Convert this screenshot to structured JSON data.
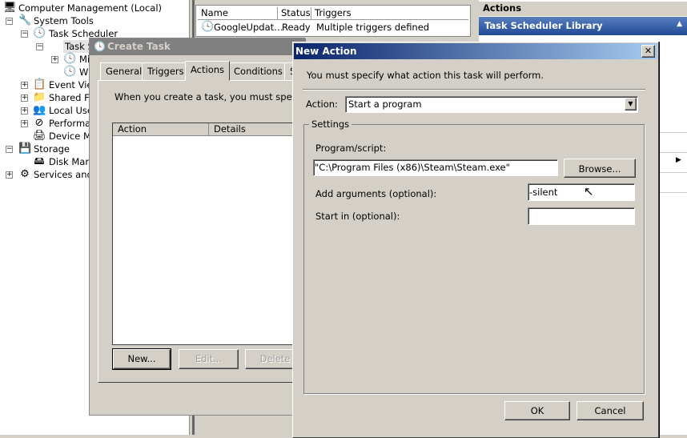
{
  "tree": {
    "items": [
      {
        "label": "Computer Management (Local)",
        "icon": "computer-icon"
      },
      {
        "label": "System Tools",
        "icon": "tools-icon",
        "expander": "−"
      },
      {
        "label": "Task Scheduler",
        "icon": "clock-icon",
        "expander": "−"
      },
      {
        "label": "Task S",
        "icon": "",
        "expander": "−"
      },
      {
        "label": "Mi",
        "icon": "task-folder-icon",
        "expander": "+"
      },
      {
        "label": "WI",
        "icon": "task-folder-icon"
      },
      {
        "label": "Event View",
        "icon": "event-viewer-icon",
        "expander": "+"
      },
      {
        "label": "Shared Fo",
        "icon": "shared-folder-icon",
        "expander": "+"
      },
      {
        "label": "Local User",
        "icon": "users-icon",
        "expander": "+"
      },
      {
        "label": "Performan",
        "icon": "performance-icon",
        "expander": "+"
      },
      {
        "label": "Device Ma",
        "icon": "device-manager-icon"
      },
      {
        "label": "Storage",
        "icon": "storage-icon",
        "expander": "−"
      },
      {
        "label": "Disk Manag",
        "icon": "disk-icon"
      },
      {
        "label": "Services and A",
        "icon": "services-icon",
        "expander": "+"
      }
    ]
  },
  "tasklist": {
    "columns": [
      "Name",
      "Status",
      "Triggers"
    ],
    "rows": [
      {
        "name": "GoogleUpdat…",
        "status": "Ready",
        "triggers": "Multiple triggers defined"
      }
    ]
  },
  "actions_pane": {
    "header": "Actions",
    "section": "Task Scheduler Library",
    "accent": "#1f4a94"
  },
  "create_task": {
    "title": "Create Task",
    "tabs": [
      "General",
      "Triggers",
      "Actions",
      "Conditions",
      "S"
    ],
    "active_tab": "Actions",
    "intro": "When you create a task, you must specify",
    "columns": [
      "Action",
      "Details"
    ],
    "buttons": {
      "new": "New...",
      "edit": "Edit...",
      "delete": "Delete"
    }
  },
  "new_action": {
    "title": "New Action",
    "close": "✕",
    "intro": "You must specify what action this task will perform.",
    "action_label": "Action:",
    "action_value": "Start a program",
    "settings_label": "Settings",
    "program_label": "Program/script:",
    "program_value": "\"C:\\Program Files (x86)\\Steam\\Steam.exe\"",
    "browse": "Browse...",
    "args_label": "Add arguments (optional):",
    "args_value": "-silent",
    "startin_label": "Start in (optional):",
    "startin_value": "",
    "ok": "OK",
    "cancel": "Cancel"
  }
}
